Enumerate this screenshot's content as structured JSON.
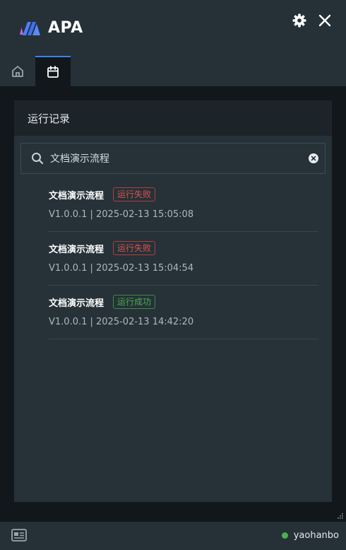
{
  "app": {
    "name": "APA"
  },
  "header": {
    "icons": {
      "settings": "gear-icon",
      "close": "close-icon"
    },
    "tabs": [
      {
        "icon": "home-icon",
        "active": false
      },
      {
        "icon": "calendar-icon",
        "active": true
      }
    ]
  },
  "panel": {
    "title": "运行记录",
    "search": {
      "value": "文档演示流程",
      "icon": "search-icon"
    },
    "records": [
      {
        "name": "文档演示流程",
        "status": "运行失败",
        "status_type": "fail",
        "meta": "V1.0.0.1 | 2025-02-13 15:05:08"
      },
      {
        "name": "文档演示流程",
        "status": "运行失败",
        "status_type": "fail",
        "meta": "V1.0.0.1 | 2025-02-13 15:04:54"
      },
      {
        "name": "文档演示流程",
        "status": "运行成功",
        "status_type": "ok",
        "meta": "V1.0.0.1 | 2025-02-13 14:42:20"
      }
    ]
  },
  "footer": {
    "icon": "id-card-icon",
    "user": {
      "name": "yaohanbo",
      "online": true
    }
  },
  "colors": {
    "accent": "#3b82f6",
    "fail": "#d9534f",
    "success": "#4caf50",
    "header_bg": "#263037",
    "panel_bg": "#263138"
  }
}
